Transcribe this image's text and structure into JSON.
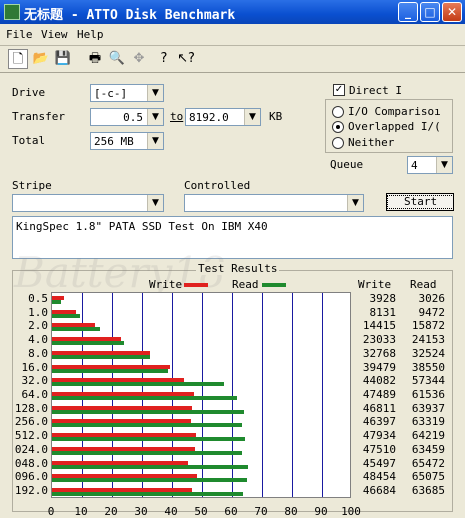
{
  "window": {
    "title": "无标题 - ATTO Disk Benchmark",
    "minimize": "_",
    "maximize": "□",
    "close": "✕"
  },
  "menu": [
    "File",
    "View",
    "Help"
  ],
  "toolbar_icons": [
    "new-icon",
    "open-icon",
    "save-icon",
    "print-icon",
    "print-preview-icon",
    "move-icon",
    "help-icon",
    "context-help-icon"
  ],
  "form": {
    "drive_label": "Drive",
    "drive_value": "[-c-]",
    "transfer_label": "Transfer",
    "transfer_from": "0.5",
    "to_label": "to",
    "transfer_to": "8192.0",
    "kb_label": "KB",
    "total_label": "Total",
    "total_value": "256 MB",
    "direct_io_label": "Direct I",
    "io_compare_label": "I/O Comparisoı",
    "overlapped_label": "Overlapped I/(",
    "neither_label": "Neither",
    "queue_label": "Queue",
    "queue_value": "4",
    "stripe_label": "Stripe",
    "controlled_label": "Controlled",
    "start_label": "Start",
    "description": "KingSpec 1.8\" PATA SSD Test On IBM X40"
  },
  "watermark": "Battery18",
  "results": {
    "title": "Test Results",
    "write_label": "Write",
    "read_label": "Read",
    "col_write": "Write",
    "col_read": "Read"
  },
  "colors": {
    "write": "#e0211f",
    "read": "#1f8a2e",
    "grid": "#1a1aa0"
  },
  "chart_data": {
    "type": "bar",
    "title": "Test Results",
    "categories": [
      "0.5",
      "1.0",
      "2.0",
      "4.0",
      "8.0",
      "16.0",
      "32.0",
      "64.0",
      "128.0",
      "256.0",
      "512.0",
      "024.0",
      "048.0",
      "096.0",
      "192.0"
    ],
    "series": [
      {
        "name": "Write",
        "values": [
          3928,
          8131,
          14415,
          23033,
          32768,
          39479,
          44082,
          47489,
          46811,
          46397,
          47934,
          47510,
          45497,
          48454,
          46684
        ]
      },
      {
        "name": "Read",
        "values": [
          3026,
          9472,
          15872,
          24153,
          32524,
          38550,
          57344,
          61536,
          63937,
          63319,
          64219,
          63459,
          65472,
          65075,
          63685
        ]
      }
    ],
    "x_ticks": [
      "0",
      "10",
      "20",
      "30",
      "40",
      "50",
      "60",
      "70",
      "80",
      "90",
      "100"
    ],
    "xlim": [
      0,
      100
    ],
    "bar_scale_max_kbps": 100000,
    "grid": true
  }
}
